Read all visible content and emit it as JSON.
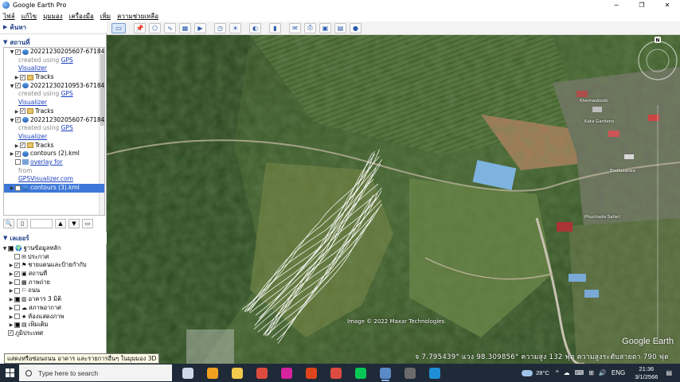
{
  "window": {
    "title": "Google Earth Pro",
    "controls": [
      "─",
      "❐",
      "✕"
    ]
  },
  "menu": [
    "ไฟล์",
    "แก้ไข",
    "มุมมอง",
    "เครื่องมือ",
    "เพิ่ม",
    "ความช่วยเหลือ"
  ],
  "toolbar": {
    "buttons": [
      "sidebar-toggle",
      "placemark",
      "polygon",
      "path",
      "image-overlay",
      "record-tour",
      "historical-imagery",
      "sunlight",
      "planets",
      "ruler",
      "email",
      "print",
      "save-image",
      "view-in-maps",
      "sky"
    ]
  },
  "sidebar": {
    "search_header": "ค้นหา",
    "places_header": "สถานที่",
    "places": [
      {
        "indent": 1,
        "expander": "▼",
        "checked": true,
        "icon": "track",
        "label": "20221230205607-67184"
      },
      {
        "indent": 3,
        "text_grey": "created using ",
        "link": "GPS"
      },
      {
        "indent": 3,
        "link": "Visualizer"
      },
      {
        "indent": 2,
        "expander": "▶",
        "checked": true,
        "icon": "folder",
        "label": "Tracks"
      },
      {
        "indent": 1,
        "expander": "▼",
        "checked": true,
        "icon": "track",
        "label": "20221230210953-67184"
      },
      {
        "indent": 3,
        "text_grey": "created using ",
        "link": "GPS"
      },
      {
        "indent": 3,
        "link": "Visualizer"
      },
      {
        "indent": 2,
        "expander": "▶",
        "checked": true,
        "icon": "folder",
        "label": "Tracks"
      },
      {
        "indent": 1,
        "expander": "▼",
        "checked": true,
        "icon": "track",
        "label": "20221230205607-67184"
      },
      {
        "indent": 3,
        "text_grey": "created using ",
        "link": "GPS"
      },
      {
        "indent": 3,
        "link": "Visualizer"
      },
      {
        "indent": 2,
        "expander": "▶",
        "checked": true,
        "icon": "folder",
        "label": "Tracks"
      },
      {
        "indent": 1,
        "expander": "▶",
        "checked": true,
        "icon": "track",
        "label": "contours (2).kml"
      },
      {
        "indent": 1,
        "expander": "",
        "checked": false,
        "icon": "overlay",
        "link": "overlay for"
      },
      {
        "indent": 3,
        "text_grey": "from"
      },
      {
        "indent": 3,
        "link": "GPSVisualizer.com"
      },
      {
        "indent": 1,
        "expander": "▶",
        "checked": true,
        "icon": "track",
        "label": "contours (3).kml",
        "selected": true
      }
    ],
    "layers_header": "เลเยอร์",
    "layers": [
      {
        "indent": 0,
        "expander": "▼",
        "checked": "partial",
        "icon": "🌍",
        "label": "ฐานข้อมูลหลัก"
      },
      {
        "indent": 1,
        "expander": "",
        "checked": false,
        "icon": "✉",
        "label": "ประกาศ"
      },
      {
        "indent": 1,
        "expander": "▶",
        "checked": true,
        "icon": "⚑",
        "label": "ชายแดนและป้ายกำกับ"
      },
      {
        "indent": 1,
        "expander": "▶",
        "checked": true,
        "icon": "▣",
        "label": "สถานที่"
      },
      {
        "indent": 1,
        "expander": "▶",
        "checked": false,
        "icon": "▦",
        "label": "ภาพถ่าย"
      },
      {
        "indent": 1,
        "expander": "▶",
        "checked": false,
        "icon": "⚐",
        "label": "ถนน"
      },
      {
        "indent": 1,
        "expander": "▶",
        "checked": "partial",
        "icon": "▥",
        "label": "อาคาร 3 มิติ"
      },
      {
        "indent": 1,
        "expander": "▶",
        "checked": false,
        "icon": "☁",
        "label": "สภาพอากาศ"
      },
      {
        "indent": 1,
        "expander": "▶",
        "checked": false,
        "icon": "★",
        "label": "ห้องแสดงภาพ"
      },
      {
        "indent": 1,
        "expander": "▶",
        "checked": "partial",
        "icon": "▤",
        "label": "เพิ่มเติม"
      },
      {
        "indent": 0,
        "expander": "",
        "checked": true,
        "icon": "",
        "label": "ภูมิประเทศ"
      }
    ]
  },
  "map": {
    "brand": "Google Earth",
    "credit": "Image © 2022 Maxar Technologies",
    "status": "จ    7.795439°  แวง   98.309856°  ความสูง   132 ฟุต    ความสูงระดับสายตา    790 ฟุต",
    "labels": [
      "Phuchada Safari",
      "Kata Gardens",
      "Bodiasanea",
      "Khemasbook"
    ],
    "tooltip": "แสดงหรือซ่อนถนน อาคาร และรายการอื่นๆ ในมุมมอง 3D"
  },
  "taskbar": {
    "search_placeholder": "Type here to search",
    "weather": "28°C",
    "language": "ENG",
    "time": "21:36",
    "date": "3/1/2566",
    "tray_icons": [
      "^",
      "☁",
      "⌨",
      "⊞",
      "🔊"
    ],
    "apps": [
      {
        "name": "task-view-icon",
        "color": "#cfd8e6"
      },
      {
        "name": "store-icon",
        "color": "#f0a020"
      },
      {
        "name": "file-explorer-icon",
        "color": "#f2c94c"
      },
      {
        "name": "chrome-icon",
        "color": "#dd4b3e"
      },
      {
        "name": "instagram-icon",
        "color": "#d6249f"
      },
      {
        "name": "office-icon",
        "color": "#e0441c"
      },
      {
        "name": "chrome-2-icon",
        "color": "#dd4b3e"
      },
      {
        "name": "line-icon",
        "color": "#06c755"
      },
      {
        "name": "google-earth-icon",
        "color": "#5b8ac8",
        "active": true
      },
      {
        "name": "calculator-icon",
        "color": "#6b6b6b"
      },
      {
        "name": "edge-icon",
        "color": "#1e8fd6"
      }
    ]
  }
}
